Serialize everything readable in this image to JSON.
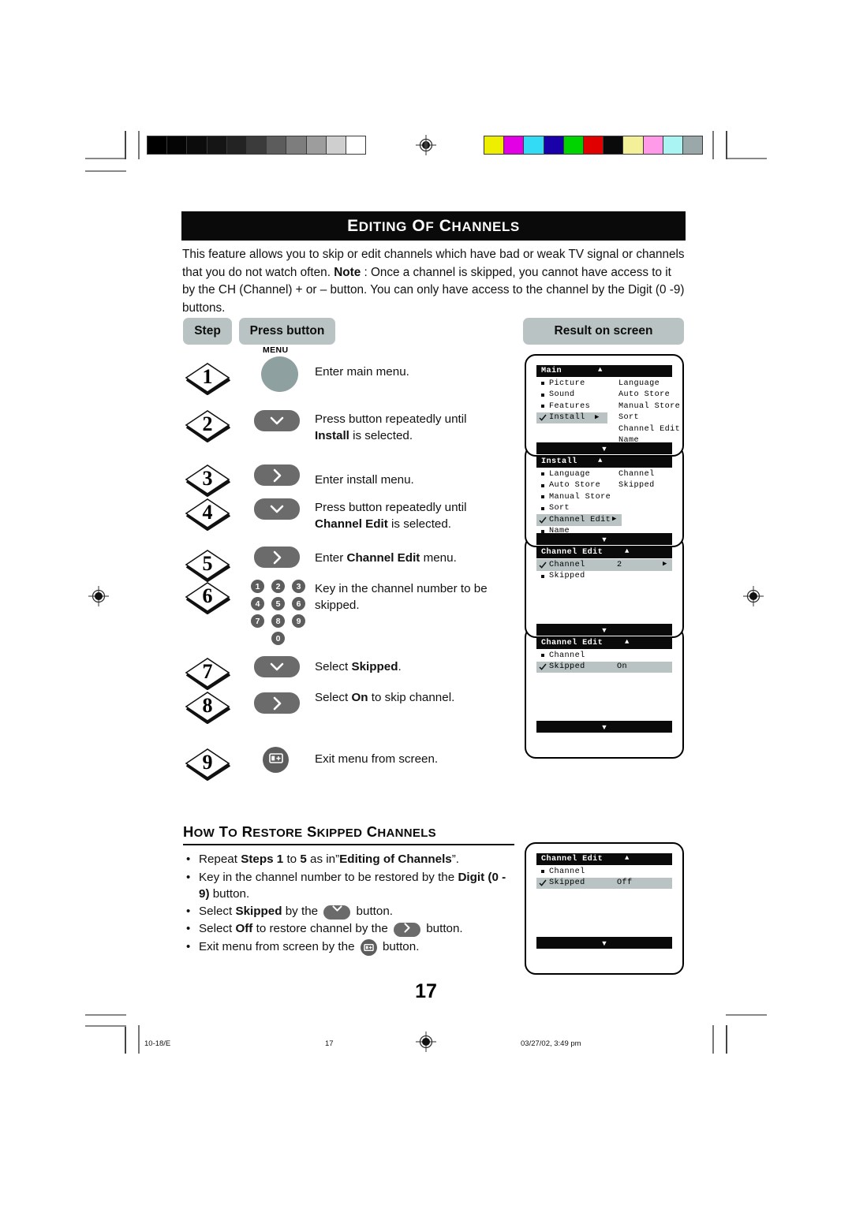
{
  "document": {
    "title": "EDITING OF CHANNELS",
    "intro": "This feature allows you to skip or edit channels which have bad or weak TV signal or channels that you do not watch often. Note : Once a channel is skipped, you cannot have access to it by the CH (Channel) + or – button. You can only have access to the channel by the Digit (0 -9) buttons.",
    "page_number": "17"
  },
  "table_headers": {
    "step": "Step",
    "press_button": "Press button",
    "result": "Result on screen"
  },
  "steps": [
    {
      "number": "1",
      "button": "menu-round",
      "button_label": "MENU",
      "description": "Enter main menu."
    },
    {
      "number": "2",
      "button": "down-arrow",
      "description": "Press button repeatedly until Install is selected."
    },
    {
      "number": "3",
      "button": "right-arrow",
      "description": "Enter install menu."
    },
    {
      "number": "4",
      "button": "down-arrow",
      "description": "Press button repeatedly until Channel Edit is selected."
    },
    {
      "number": "5",
      "button": "right-arrow",
      "description": "Enter Channel Edit menu."
    },
    {
      "number": "6",
      "button": "digit-keypad",
      "description": "Key in the channel number to be skipped."
    },
    {
      "number": "7",
      "button": "down-arrow",
      "description": "Select Skipped."
    },
    {
      "number": "8",
      "button": "right-arrow",
      "description": "Select On to skip channel."
    },
    {
      "number": "9",
      "button": "exit-icon",
      "description": "Exit menu from screen."
    }
  ],
  "keypad": [
    "1",
    "2",
    "3",
    "4",
    "5",
    "6",
    "7",
    "8",
    "9",
    "0"
  ],
  "restore_section": {
    "heading": "HOW TO RESTORE SKIPPED CHANNELS",
    "bullets": [
      "Repeat Steps 1 to 5 as in”Editing of Channels”.",
      "Key in the channel number to be restored by the Digit (0 - 9) button.",
      "Select Skipped by the  button.",
      "Select Off to restore channel by the  button.",
      "Exit menu from screen by the  button."
    ]
  },
  "tv_screens": [
    {
      "id": "main-menu",
      "title": "Main",
      "up_arrow": "▲",
      "down_arrow": "▼",
      "rows": [
        {
          "marker": "square",
          "label": "Picture",
          "col2": "Language"
        },
        {
          "marker": "square",
          "label": "Sound",
          "col2": "Auto Store"
        },
        {
          "marker": "square",
          "label": "Features",
          "col2": "Manual Store"
        },
        {
          "marker": "check",
          "label": "Install",
          "col2": "Sort",
          "selected": true,
          "arrow": "▶"
        },
        {
          "marker": "none",
          "label": "",
          "col2": "Channel Edit"
        },
        {
          "marker": "none",
          "label": "",
          "col2": "Name"
        }
      ]
    },
    {
      "id": "install-menu",
      "title": "Install",
      "up_arrow": "▲",
      "down_arrow": "▼",
      "rows": [
        {
          "marker": "square",
          "label": "Language",
          "col2": "Channel"
        },
        {
          "marker": "square",
          "label": "Auto Store",
          "col2": "Skipped"
        },
        {
          "marker": "square",
          "label": "Manual Store",
          "col2": ""
        },
        {
          "marker": "square",
          "label": "Sort",
          "col2": ""
        },
        {
          "marker": "check",
          "label": "Channel Edit",
          "col2": "",
          "selected": true,
          "arrow": "▶"
        },
        {
          "marker": "square",
          "label": "Name",
          "col2": ""
        }
      ]
    },
    {
      "id": "channel-edit-channel",
      "title": "Channel Edit",
      "up_arrow": "▲",
      "down_arrow": "▼",
      "rows": [
        {
          "marker": "check",
          "label": "Channel",
          "value": "2",
          "selected": true,
          "arrow": "▶"
        },
        {
          "marker": "square",
          "label": "Skipped",
          "value": ""
        }
      ]
    },
    {
      "id": "channel-edit-skipped-on",
      "title": "Channel Edit",
      "up_arrow": "▲",
      "down_arrow": "▼",
      "rows": [
        {
          "marker": "square",
          "label": "Channel",
          "value": ""
        },
        {
          "marker": "check",
          "label": "Skipped",
          "value": "On",
          "selected": true
        }
      ]
    },
    {
      "id": "channel-edit-skipped-off",
      "title": "Channel Edit",
      "up_arrow": "▲",
      "down_arrow": "▼",
      "rows": [
        {
          "marker": "square",
          "label": "Channel",
          "value": ""
        },
        {
          "marker": "check",
          "label": "Skipped",
          "value": "Off",
          "selected": true
        }
      ]
    }
  ],
  "footer": {
    "left": "10-18/E",
    "center": "17",
    "right": "03/27/02, 3:49 pm"
  },
  "printer_marks": {
    "grayscale_bar": [
      "#000000",
      "#050505",
      "#0c0c0c",
      "#151515",
      "#232323",
      "#3b3b3b",
      "#5c5c5c",
      "#7d7d7d",
      "#9d9d9d",
      "#cfcfcf",
      "#ffffff"
    ],
    "color_bar": [
      "#eeee00",
      "#e400e4",
      "#33dcf4",
      "#1a00a8",
      "#00d400",
      "#e00000",
      "#0a0a0a",
      "#f4f09a",
      "#ff9ae8",
      "#aaf4f4",
      "#9aa8aa"
    ]
  },
  "colors": {
    "header_bg": "#0a0a0a",
    "pill_bg": "#b9c3c3",
    "remote_button": "#6b6b6b",
    "menu_button": "#8fa0a0",
    "osd_highlight": "#b9c3c3"
  }
}
